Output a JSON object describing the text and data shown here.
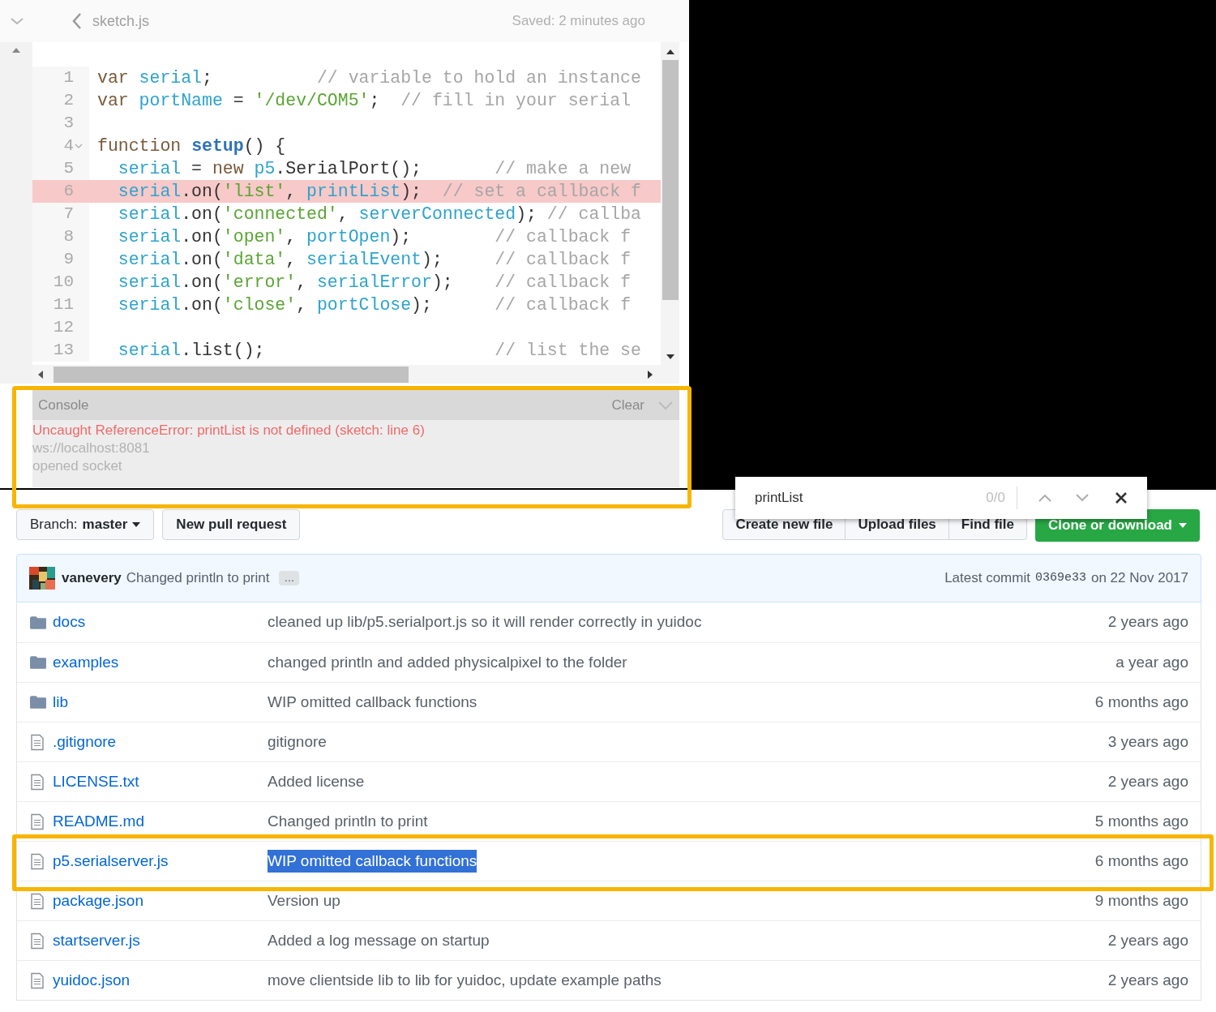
{
  "editor": {
    "file_name": "sketch.js",
    "save_status": "Saved: 2 minutes ago",
    "lines": [
      {
        "number": "1",
        "highlighted": false,
        "foldable": false,
        "tokens": [
          {
            "kind": "keyword",
            "text": "var "
          },
          {
            "kind": "variable",
            "text": "serial"
          },
          {
            "kind": "plain",
            "text": ";"
          },
          {
            "kind": "comment",
            "text": "          // variable to hold an instance"
          }
        ]
      },
      {
        "number": "2",
        "highlighted": false,
        "foldable": false,
        "tokens": [
          {
            "kind": "keyword",
            "text": "var "
          },
          {
            "kind": "variable",
            "text": "portName"
          },
          {
            "kind": "plain",
            "text": " = "
          },
          {
            "kind": "string",
            "text": "'/dev/COM5'"
          },
          {
            "kind": "plain",
            "text": ";"
          },
          {
            "kind": "comment",
            "text": "  // fill in your serial"
          }
        ]
      },
      {
        "number": "3",
        "highlighted": false,
        "foldable": false
      },
      {
        "number": "4",
        "highlighted": false,
        "foldable": true,
        "tokens": [
          {
            "kind": "keyword",
            "text": "function "
          },
          {
            "kind": "definition",
            "text": "setup"
          },
          {
            "kind": "plain",
            "text": "() {"
          }
        ]
      },
      {
        "number": "5",
        "highlighted": false,
        "foldable": false,
        "tokens": [
          {
            "kind": "variable",
            "text": "  serial"
          },
          {
            "kind": "plain",
            "text": " = "
          },
          {
            "kind": "keyword",
            "text": "new "
          },
          {
            "kind": "variable",
            "text": "p5"
          },
          {
            "kind": "plain",
            "text": ".SerialPort();"
          },
          {
            "kind": "comment",
            "text": "       // make a new"
          }
        ]
      },
      {
        "number": "6",
        "highlighted": true,
        "foldable": false,
        "tokens": [
          {
            "kind": "variable",
            "text": "  serial"
          },
          {
            "kind": "plain",
            "text": ".on("
          },
          {
            "kind": "string",
            "text": "'list'"
          },
          {
            "kind": "plain",
            "text": ", "
          },
          {
            "kind": "variable",
            "text": "printList"
          },
          {
            "kind": "plain",
            "text": ");"
          },
          {
            "kind": "comment",
            "text": "  // set a callback f"
          }
        ]
      },
      {
        "number": "7",
        "highlighted": false,
        "foldable": false,
        "tokens": [
          {
            "kind": "variable",
            "text": "  serial"
          },
          {
            "kind": "plain",
            "text": ".on("
          },
          {
            "kind": "string",
            "text": "'connected'"
          },
          {
            "kind": "plain",
            "text": ", "
          },
          {
            "kind": "variable",
            "text": "serverConnected"
          },
          {
            "kind": "plain",
            "text": ");"
          },
          {
            "kind": "comment",
            "text": " // callba"
          }
        ]
      },
      {
        "number": "8",
        "highlighted": false,
        "foldable": false,
        "tokens": [
          {
            "kind": "variable",
            "text": "  serial"
          },
          {
            "kind": "plain",
            "text": ".on("
          },
          {
            "kind": "string",
            "text": "'open'"
          },
          {
            "kind": "plain",
            "text": ", "
          },
          {
            "kind": "variable",
            "text": "portOpen"
          },
          {
            "kind": "plain",
            "text": ");"
          },
          {
            "kind": "comment",
            "text": "        // callback f"
          }
        ]
      },
      {
        "number": "9",
        "highlighted": false,
        "foldable": false,
        "tokens": [
          {
            "kind": "variable",
            "text": "  serial"
          },
          {
            "kind": "plain",
            "text": ".on("
          },
          {
            "kind": "string",
            "text": "'data'"
          },
          {
            "kind": "plain",
            "text": ", "
          },
          {
            "kind": "variable",
            "text": "serialEvent"
          },
          {
            "kind": "plain",
            "text": ");"
          },
          {
            "kind": "comment",
            "text": "     // callback f"
          }
        ]
      },
      {
        "number": "10",
        "highlighted": false,
        "foldable": false,
        "tokens": [
          {
            "kind": "variable",
            "text": "  serial"
          },
          {
            "kind": "plain",
            "text": ".on("
          },
          {
            "kind": "string",
            "text": "'error'"
          },
          {
            "kind": "plain",
            "text": ", "
          },
          {
            "kind": "variable",
            "text": "serialError"
          },
          {
            "kind": "plain",
            "text": ");"
          },
          {
            "kind": "comment",
            "text": "    // callback f"
          }
        ]
      },
      {
        "number": "11",
        "highlighted": false,
        "foldable": false,
        "tokens": [
          {
            "kind": "variable",
            "text": "  serial"
          },
          {
            "kind": "plain",
            "text": ".on("
          },
          {
            "kind": "string",
            "text": "'close'"
          },
          {
            "kind": "plain",
            "text": ", "
          },
          {
            "kind": "variable",
            "text": "portClose"
          },
          {
            "kind": "plain",
            "text": ");"
          },
          {
            "kind": "comment",
            "text": "      // callback f"
          }
        ]
      },
      {
        "number": "12",
        "highlighted": false,
        "foldable": false
      },
      {
        "number": "13",
        "highlighted": false,
        "foldable": false,
        "tokens": [
          {
            "kind": "variable",
            "text": "  serial"
          },
          {
            "kind": "plain",
            "text": ".list();"
          },
          {
            "kind": "comment",
            "text": "                      // list the se"
          }
        ]
      }
    ]
  },
  "console": {
    "title": "Console",
    "clear_label": "Clear",
    "outlined": true,
    "messages": [
      {
        "kind": "error",
        "text": "Uncaught ReferenceError: printList is not defined (sketch: line 6)"
      },
      {
        "kind": "log",
        "text": "ws://localhost:8081"
      },
      {
        "kind": "log",
        "text": "opened socket"
      }
    ]
  },
  "find_bar": {
    "query": "printList",
    "count": "0/0"
  },
  "repo": {
    "branch_label": "Branch:",
    "branch": "master",
    "pull_request_button": "New pull request",
    "file_buttons": [
      "Create new file",
      "Upload files",
      "Find file"
    ],
    "clone_button": "Clone or download",
    "commit": {
      "author": "vanevery",
      "message": "Changed println to print",
      "ellipsis": "…",
      "latest_label": "Latest commit",
      "sha": "0369e33",
      "date": "on 22 Nov 2017"
    },
    "files": [
      {
        "kind": "folder",
        "name": "docs",
        "message": "cleaned up lib/p5.serialport.js so it will render correctly in yuidoc",
        "age": "2 years ago",
        "message_selected": false,
        "outlined": false
      },
      {
        "kind": "folder",
        "name": "examples",
        "message": "changed println and added physicalpixel to the folder",
        "age": "a year ago",
        "message_selected": false,
        "outlined": false
      },
      {
        "kind": "folder",
        "name": "lib",
        "message": "WIP omitted callback functions",
        "age": "6 months ago",
        "message_selected": false,
        "outlined": false
      },
      {
        "kind": "file",
        "name": ".gitignore",
        "message": "gitignore",
        "age": "3 years ago",
        "message_selected": false,
        "outlined": false
      },
      {
        "kind": "file",
        "name": "LICENSE.txt",
        "message": "Added license",
        "age": "2 years ago",
        "message_selected": false,
        "outlined": false
      },
      {
        "kind": "file",
        "name": "README.md",
        "message": "Changed println to print",
        "age": "5 months ago",
        "message_selected": false,
        "outlined": false
      },
      {
        "kind": "file",
        "name": "p5.serialserver.js",
        "message": "WIP omitted callback functions",
        "age": "6 months ago",
        "message_selected": true,
        "outlined": true
      },
      {
        "kind": "file",
        "name": "package.json",
        "message": "Version up",
        "age": "9 months ago",
        "message_selected": false,
        "outlined": false
      },
      {
        "kind": "file",
        "name": "startserver.js",
        "message": "Added a log message on startup",
        "age": "2 years ago",
        "message_selected": false,
        "outlined": false
      },
      {
        "kind": "file",
        "name": "yuidoc.json",
        "message": "move clientside lib to lib for yuidoc, update example paths",
        "age": "2 years ago",
        "message_selected": false,
        "outlined": false
      }
    ]
  }
}
